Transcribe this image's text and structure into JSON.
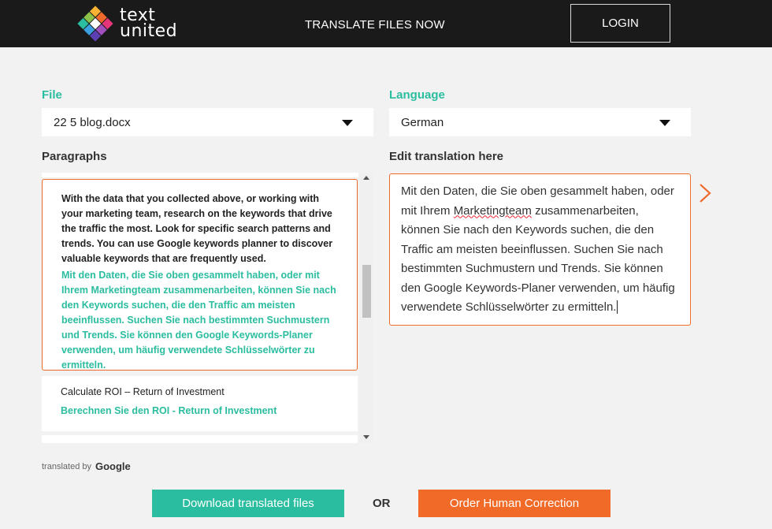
{
  "header": {
    "logo_line1": "text",
    "logo_line2": "united",
    "nav_translate": "TRANSLATE FILES NOW",
    "login_label": "LOGIN"
  },
  "file": {
    "label": "File",
    "selected": "22 5 blog.docx"
  },
  "language": {
    "label": "Language",
    "selected": "German"
  },
  "paragraphs": {
    "label": "Paragraphs",
    "items": [
      {
        "source": "With the data that you collected above, or working with your marketing team, research on the keywords that drive the traffic the most. Look for specific search patterns and trends. You can use Google keywords planner to discover valuable keywords that are frequently used.",
        "translation": "Mit den Daten, die Sie oben gesammelt haben, oder mit Ihrem Marketingteam zusammenarbeiten, können Sie nach den Keywords suchen, die den Traffic am meisten beeinflussen. Suchen Sie nach bestimmten Suchmustern und Trends. Sie können den Google Keywords-Planer verwenden, um häufig verwendete Schlüsselwörter zu ermitteln.",
        "active": true
      },
      {
        "source": "Calculate ROI – Return of Investment",
        "translation": "Berechnen Sie den ROI - Return of Investment",
        "active": false
      }
    ]
  },
  "editor": {
    "label": "Edit translation here",
    "text_before": "Mit den Daten, die Sie oben gesammelt haben, oder mit Ihrem ",
    "text_misspelled": "Marketingteam",
    "text_after": " zusammenarbeiten, können Sie nach den Keywords suchen, die den Traffic am meisten beeinflussen. Suchen Sie nach bestimmten Suchmustern und Trends. Sie können den Google Keywords-Planer verwenden, um häufig verwendete Schlüsselwörter zu ermitteln."
  },
  "footer": {
    "translated_by": "translated by",
    "provider": "Google",
    "download_label": "Download translated files",
    "or_label": "OR",
    "order_label": "Order Human Correction"
  },
  "colors": {
    "accent_green": "#2bbd9f",
    "accent_orange": "#f26a27",
    "header_bg": "#1a1a1a"
  },
  "icons": [
    "textunited-logo-icon",
    "dropdown-caret-icon",
    "next-arrow-icon",
    "scroll-up-icon",
    "scroll-down-icon"
  ]
}
